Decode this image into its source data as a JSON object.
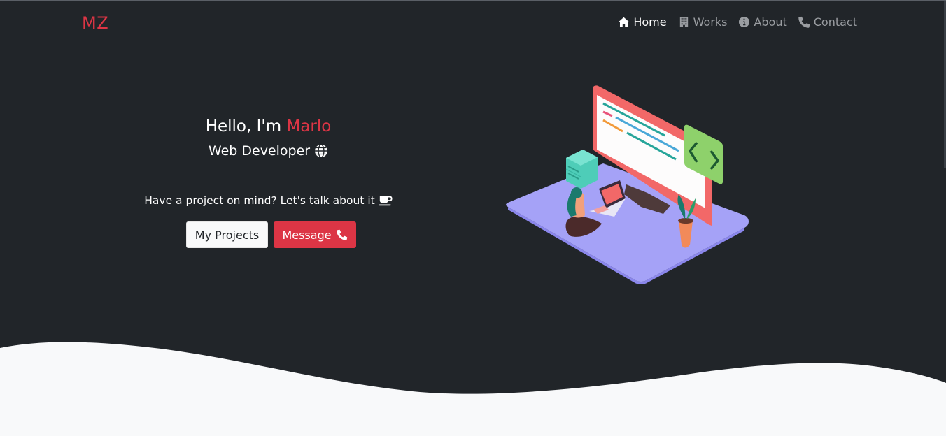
{
  "nav": {
    "brand": "MZ",
    "items": [
      {
        "label": "Home",
        "icon": "home-icon",
        "active": true
      },
      {
        "label": "Works",
        "icon": "building-icon",
        "active": false
      },
      {
        "label": "About",
        "icon": "info-circle-icon",
        "active": false
      },
      {
        "label": "Contact",
        "icon": "phone-icon",
        "active": false
      }
    ]
  },
  "hero": {
    "greeting_prefix": "Hello, I'm",
    "greeting_name": "Marlo",
    "role": "Web Developer",
    "role_icon": "globe-icon",
    "tagline": "Have a project on mind? Let's talk about it",
    "tagline_icon": "coffee-mug-icon",
    "buttons": {
      "projects": "My Projects",
      "message": "Message",
      "message_icon": "phone-icon"
    }
  },
  "colors": {
    "background": "#212529",
    "accent": "#dc3545",
    "light": "#f8f9fa",
    "nav_muted": "#9a9da1"
  }
}
